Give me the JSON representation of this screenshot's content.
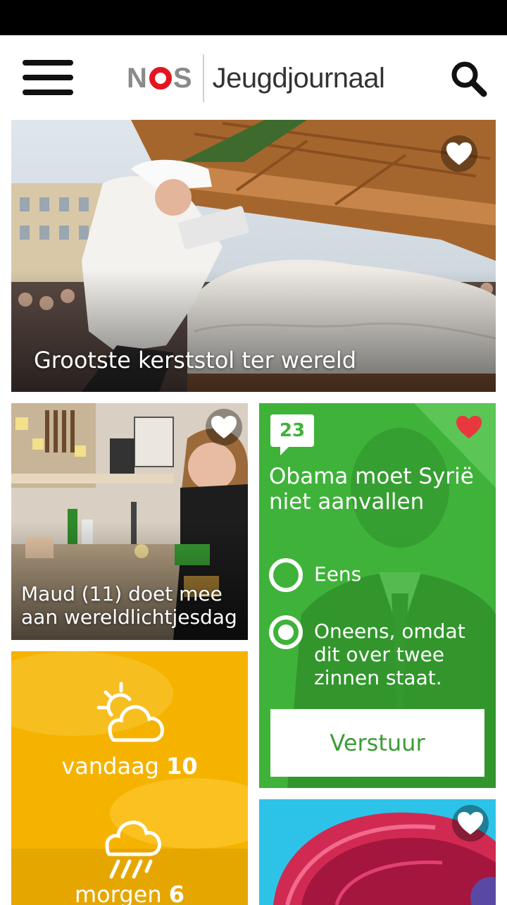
{
  "header": {
    "logo_brand": "NOS",
    "logo_title": "Jeugdjournaal"
  },
  "hero": {
    "title": "Grootste kerststol ter wereld",
    "favorite": false
  },
  "tile_maud": {
    "title": "Maud (11) doet mee aan wereldlichtjesdag",
    "favorite": false
  },
  "poll": {
    "comment_count": "23",
    "question": "Obama moet Syrië niet aanvallen",
    "options": [
      {
        "label": "Eens",
        "selected": false
      },
      {
        "label": "Oneens, omdat dit over twee zinnen staat.",
        "selected": true
      }
    ],
    "submit_label": "Verstuur",
    "favorite": true,
    "accent_color": "#3fb23a"
  },
  "weather": {
    "today_label": "vandaag",
    "today_temp": "10",
    "tomorrow_label": "morgen",
    "tomorrow_temp": "6",
    "today_icon": "partly-cloudy-icon",
    "tomorrow_icon": "rain-cloud-icon"
  },
  "promo": {
    "favorite": false
  },
  "colors": {
    "poll_green": "#3fb23a",
    "weather_yellow": "#f5b300",
    "heart_red": "#e8383d",
    "nos_red": "#e4151f"
  }
}
